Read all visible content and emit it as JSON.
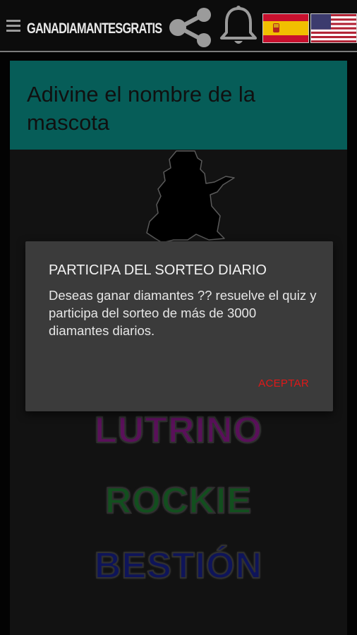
{
  "topbar": {
    "title": "GANADIAMANTESGRATIS",
    "icons": [
      "menu-icon",
      "share-icon",
      "bell-icon",
      "spain-flag-icon",
      "usa-flag-icon"
    ]
  },
  "question": {
    "text": "Adivine el nombre de la mascota"
  },
  "options": [
    {
      "label": "LUTRINO",
      "color": "#8a1a8a"
    },
    {
      "label": "ROCKIE",
      "color": "#1c7a2f"
    },
    {
      "label": "BESTIÓN",
      "color": "#16208a"
    }
  ],
  "dialog": {
    "title": "PARTICIPA DEL SORTEO DIARIO",
    "body": "Deseas ganar diamantes ?? resuelve el quiz y participa del sorteo de más de 3000 diamantes diarios.",
    "button": "ACEPTAR"
  },
  "colors": {
    "accent": "#0a8f87",
    "dialog_bg": "#3b3b3b",
    "button": "#e01818"
  }
}
